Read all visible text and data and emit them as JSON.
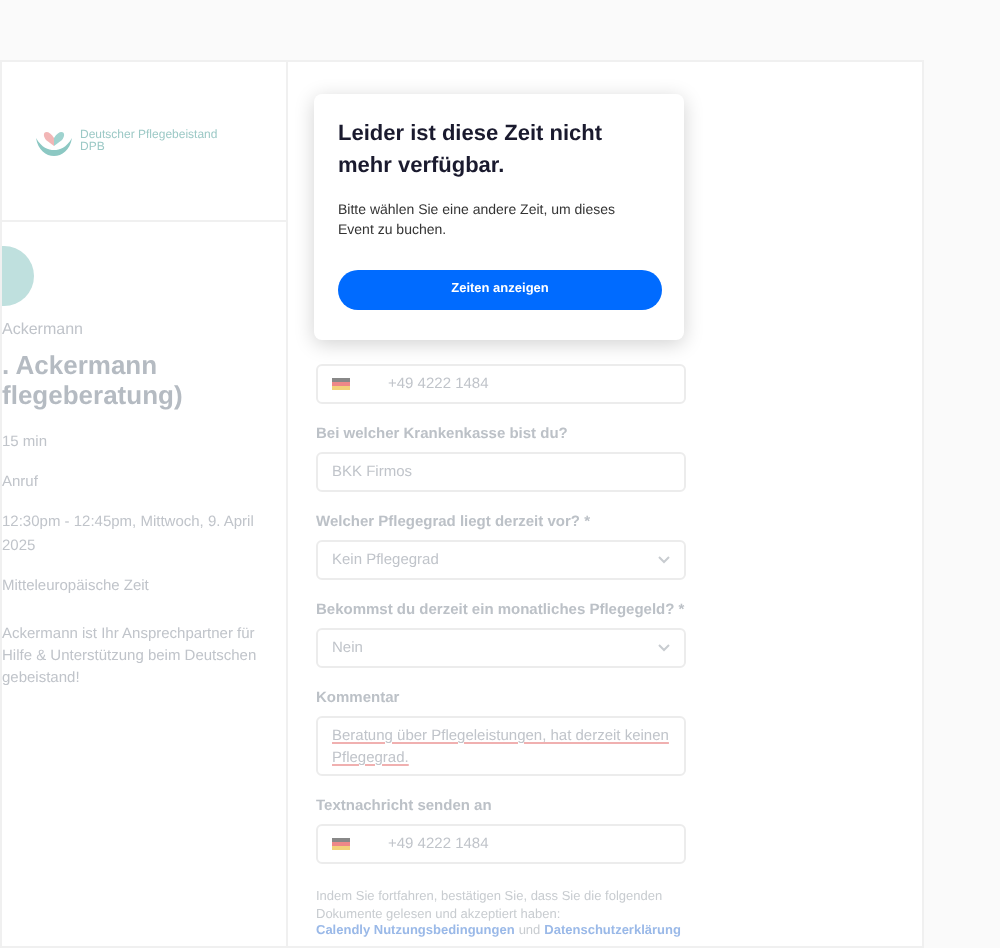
{
  "sidebar": {
    "logo": {
      "name": "Deutscher Pflegebeistand",
      "short": "DPB"
    },
    "host": "Ackermann",
    "title_lines": [
      ". Ackermann",
      "flegeberatung)"
    ],
    "details": [
      {
        "kind": "duration",
        "text": "15 min"
      },
      {
        "kind": "call",
        "text": "Anruf"
      },
      {
        "kind": "date",
        "text": "12:30pm - 12:45pm, Mittwoch, 9. April 2025"
      },
      {
        "kind": "timezone",
        "text": "Mitteleuropäische Zeit"
      }
    ],
    "description_lines": [
      "Ackermann ist Ihr Ansprechpartner für",
      "Hilfe & Unterstützung beim Deutschen",
      "gebeistand!"
    ]
  },
  "form": {
    "fields": [
      {
        "kind": "phone",
        "value": "+49 4222 1484"
      },
      {
        "kind": "text",
        "label": "Bei welcher Krankenkasse bist du?",
        "value": "BKK Firmos"
      },
      {
        "kind": "select",
        "label": "Welcher Pflegegrad liegt derzeit vor? *",
        "value": "Kein Pflegegrad"
      },
      {
        "kind": "select",
        "label": "Bekommst du derzeit ein monatliches Pflegegeld? *",
        "value": "Nein"
      },
      {
        "kind": "textarea",
        "label": "Kommentar",
        "value": "Beratung über Pflegeleistungen, hat derzeit keinen Pflegegrad."
      },
      {
        "kind": "phone",
        "label": "Textnachricht senden an",
        "value": "+49 4222 1484"
      }
    ],
    "legal": "Indem Sie fortfahren, bestätigen Sie, dass Sie die folgenden Dokumente gelesen und akzeptiert haben:",
    "links": [
      "Calendly Nutzungsbedingungen",
      "Datenschutzerklärung"
    ],
    "connector": "und"
  },
  "modal": {
    "title": "Leider ist diese Zeit nicht mehr verfügbar.",
    "message": "Bitte wählen Sie eine andere Zeit, um dieses Event zu buchen.",
    "button": "Zeiten anzeigen"
  }
}
